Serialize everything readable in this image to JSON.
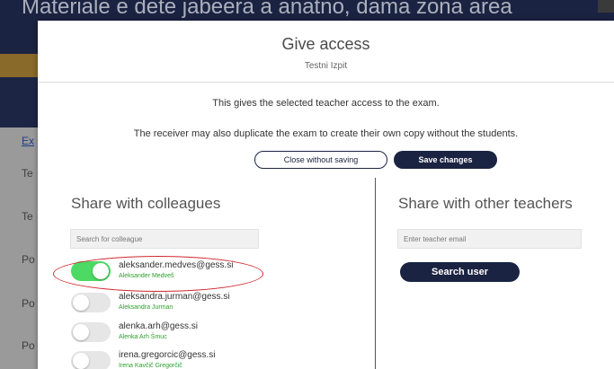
{
  "background": {
    "topline_text": "Materiale e dete jabeera a anatno, dama zona area",
    "left_items": [
      "Ex",
      "Te",
      "Te",
      "Po",
      "Po",
      "Po"
    ]
  },
  "modal": {
    "title": "Give access",
    "subtitle": "Testni Izpit",
    "description_1": "This gives the selected teacher access to the exam.",
    "description_2": "The receiver may also duplicate the exam to create their own copy without the students.",
    "close_label": "Close without saving",
    "save_label": "Save changes",
    "colleagues": {
      "title": "Share with colleagues",
      "search_placeholder": "Search for colleague",
      "list": [
        {
          "email": "aleksander.medves@gess.si",
          "name": "Aleksander Medveš",
          "enabled": true
        },
        {
          "email": "aleksandra.jurman@gess.si",
          "name": "Aleksandra Jurman",
          "enabled": false
        },
        {
          "email": "alenka.arh@gess.si",
          "name": "Alenka Arh Šmuc",
          "enabled": false
        },
        {
          "email": "irena.gregorcic@gess.si",
          "name": "Irena Kavčič Gregorčič",
          "enabled": false
        }
      ]
    },
    "other_teachers": {
      "title": "Share with other teachers",
      "email_placeholder": "Enter teacher email",
      "search_label": "Search user"
    }
  },
  "colors": {
    "navy": "#1b2342",
    "toggle_on": "#4cd964",
    "name_green": "#2d9e2d",
    "highlight_red": "#d0282e"
  }
}
